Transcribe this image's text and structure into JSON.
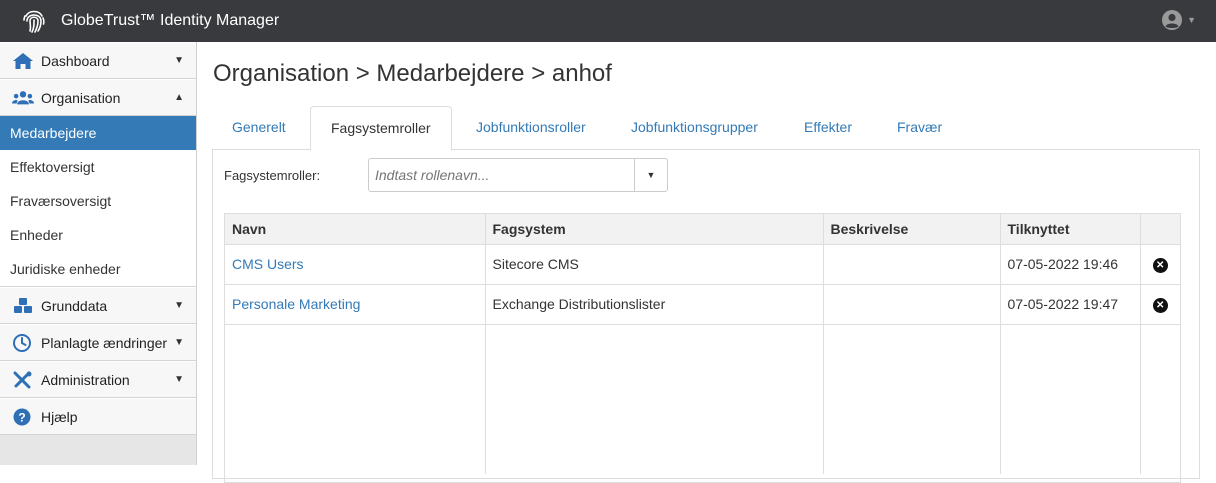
{
  "app": {
    "title": "GlobeTrust™ Identity Manager",
    "logo_icon": "fingerprint-icon",
    "user_icon": "user-circle-icon"
  },
  "sidebar": {
    "groups": [
      {
        "label": "Dashboard",
        "icon": "home-icon",
        "state": "collapsed"
      },
      {
        "label": "Organisation",
        "icon": "users-icon",
        "state": "expanded",
        "items": [
          "Medarbejdere",
          "Effektoversigt",
          "Fraværsoversigt",
          "Enheder",
          "Juridiske enheder"
        ],
        "active_item": "Medarbejdere"
      },
      {
        "label": "Grunddata",
        "icon": "cubes-icon",
        "state": "collapsed"
      },
      {
        "label": "Planlagte ændringer",
        "icon": "clock-icon",
        "state": "collapsed"
      },
      {
        "label": "Administration",
        "icon": "tools-icon",
        "state": "collapsed"
      },
      {
        "label": "Hjælp",
        "icon": "question-circle-icon",
        "state": "none"
      }
    ]
  },
  "page": {
    "title": "Organisation > Medarbejdere > anhof"
  },
  "tabs": [
    {
      "label": "Generelt",
      "active": false
    },
    {
      "label": "Fagsystemroller",
      "active": true
    },
    {
      "label": "Jobfunktionsroller",
      "active": false
    },
    {
      "label": "Jobfunktionsgrupper",
      "active": false
    },
    {
      "label": "Effekter",
      "active": false
    },
    {
      "label": "Fravær",
      "active": false
    }
  ],
  "filter": {
    "label": "Fagsystemroller:",
    "placeholder": "Indtast rollenavn..."
  },
  "table": {
    "headers": [
      "Navn",
      "Fagsystem",
      "Beskrivelse",
      "Tilknyttet"
    ],
    "rows": [
      {
        "name": "CMS Users",
        "system": "Sitecore CMS",
        "description": "",
        "attached": "07-05-2022 19:46"
      },
      {
        "name": "Personale Marketing",
        "system": "Exchange Distributionslister",
        "description": "",
        "attached": "07-05-2022 19:47"
      }
    ]
  },
  "colors": {
    "topbar": "#383a3d",
    "accent": "#337ab7",
    "sidebar_icon": "#2f6fb5"
  }
}
